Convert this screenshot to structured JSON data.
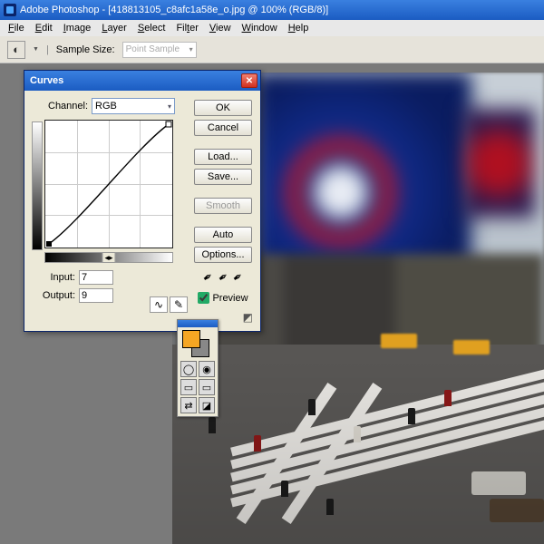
{
  "titlebar": {
    "text": "Adobe Photoshop - [418813105_c8afc1a58e_o.jpg @ 100% (RGB/8)]"
  },
  "menu": [
    "File",
    "Edit",
    "Image",
    "Layer",
    "Select",
    "Filter",
    "View",
    "Window",
    "Help"
  ],
  "optionsbar": {
    "label": "Sample Size:",
    "value": "Point Sample"
  },
  "dialog": {
    "title": "Curves",
    "channel_label": "Channel:",
    "channel_value": "RGB",
    "input_label": "Input:",
    "input_value": "7",
    "output_label": "Output:",
    "output_value": "9",
    "buttons": {
      "ok": "OK",
      "cancel": "Cancel",
      "load": "Load...",
      "save": "Save...",
      "smooth": "Smooth",
      "auto": "Auto",
      "options": "Options..."
    },
    "preview_label": "Preview"
  }
}
